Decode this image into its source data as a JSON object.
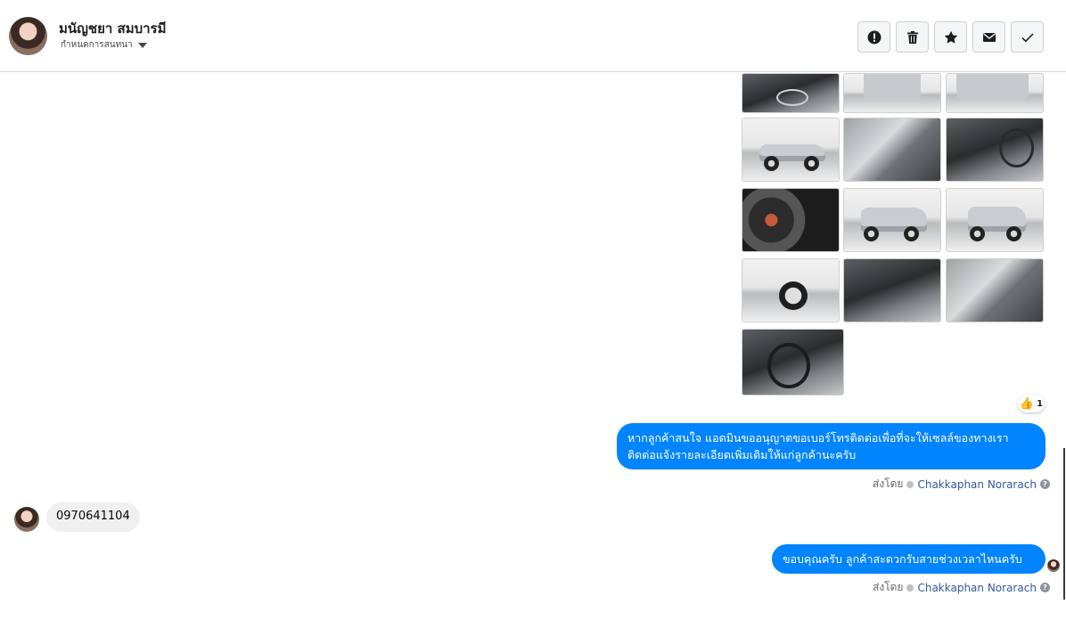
{
  "header": {
    "contact_name": "มนัญชยา สมบารมี",
    "conversation_label": "กำหนดการสนทนา",
    "actions": [
      {
        "name": "report-spam-button",
        "icon": "alert-icon"
      },
      {
        "name": "delete-button",
        "icon": "trash-icon"
      },
      {
        "name": "star-button",
        "icon": "star-icon"
      },
      {
        "name": "mark-unread-button",
        "icon": "envelope-icon"
      },
      {
        "name": "mark-done-button",
        "icon": "check-icon"
      }
    ]
  },
  "gallery": {
    "photos": [
      "engine-bay",
      "rear-view",
      "rear-three-quarter",
      "side-profile",
      "front-seats",
      "dashboard",
      "instrument-cluster",
      "front-three-quarter",
      "front-view",
      "wheel-closeup",
      "gear-shifter",
      "door-interior",
      "steering-wheel"
    ]
  },
  "reaction": {
    "icon": "thumbs-up-icon",
    "count": "1"
  },
  "messages": [
    {
      "direction": "outgoing",
      "line1": "หากลูกค้าสนใจ แอดมินขออนุญาตขอเบอร์โทรติดต่อเพื่อที่จะให้เซลล์ของทางเรา",
      "line2": "ติดต่อแจ้งรายละเอียดเพิ่มเติมให้แก่ลูกค้านะครับ",
      "sent_by_label": "ส่งโดย",
      "agent": "Chakkaphan Norarach"
    },
    {
      "direction": "incoming",
      "text": "0970641104"
    },
    {
      "direction": "outgoing",
      "text": "ขอบคุณครับ ลูกค้าสะดวกรับสายช่วงเวลาไหนครับ",
      "sent_by_label": "ส่งโดย",
      "agent": "Chakkaphan Norarach"
    }
  ],
  "colors": {
    "outgoing_bubble": "#0084ff",
    "incoming_bubble": "#f0f0f0",
    "agent_link": "#385898"
  }
}
